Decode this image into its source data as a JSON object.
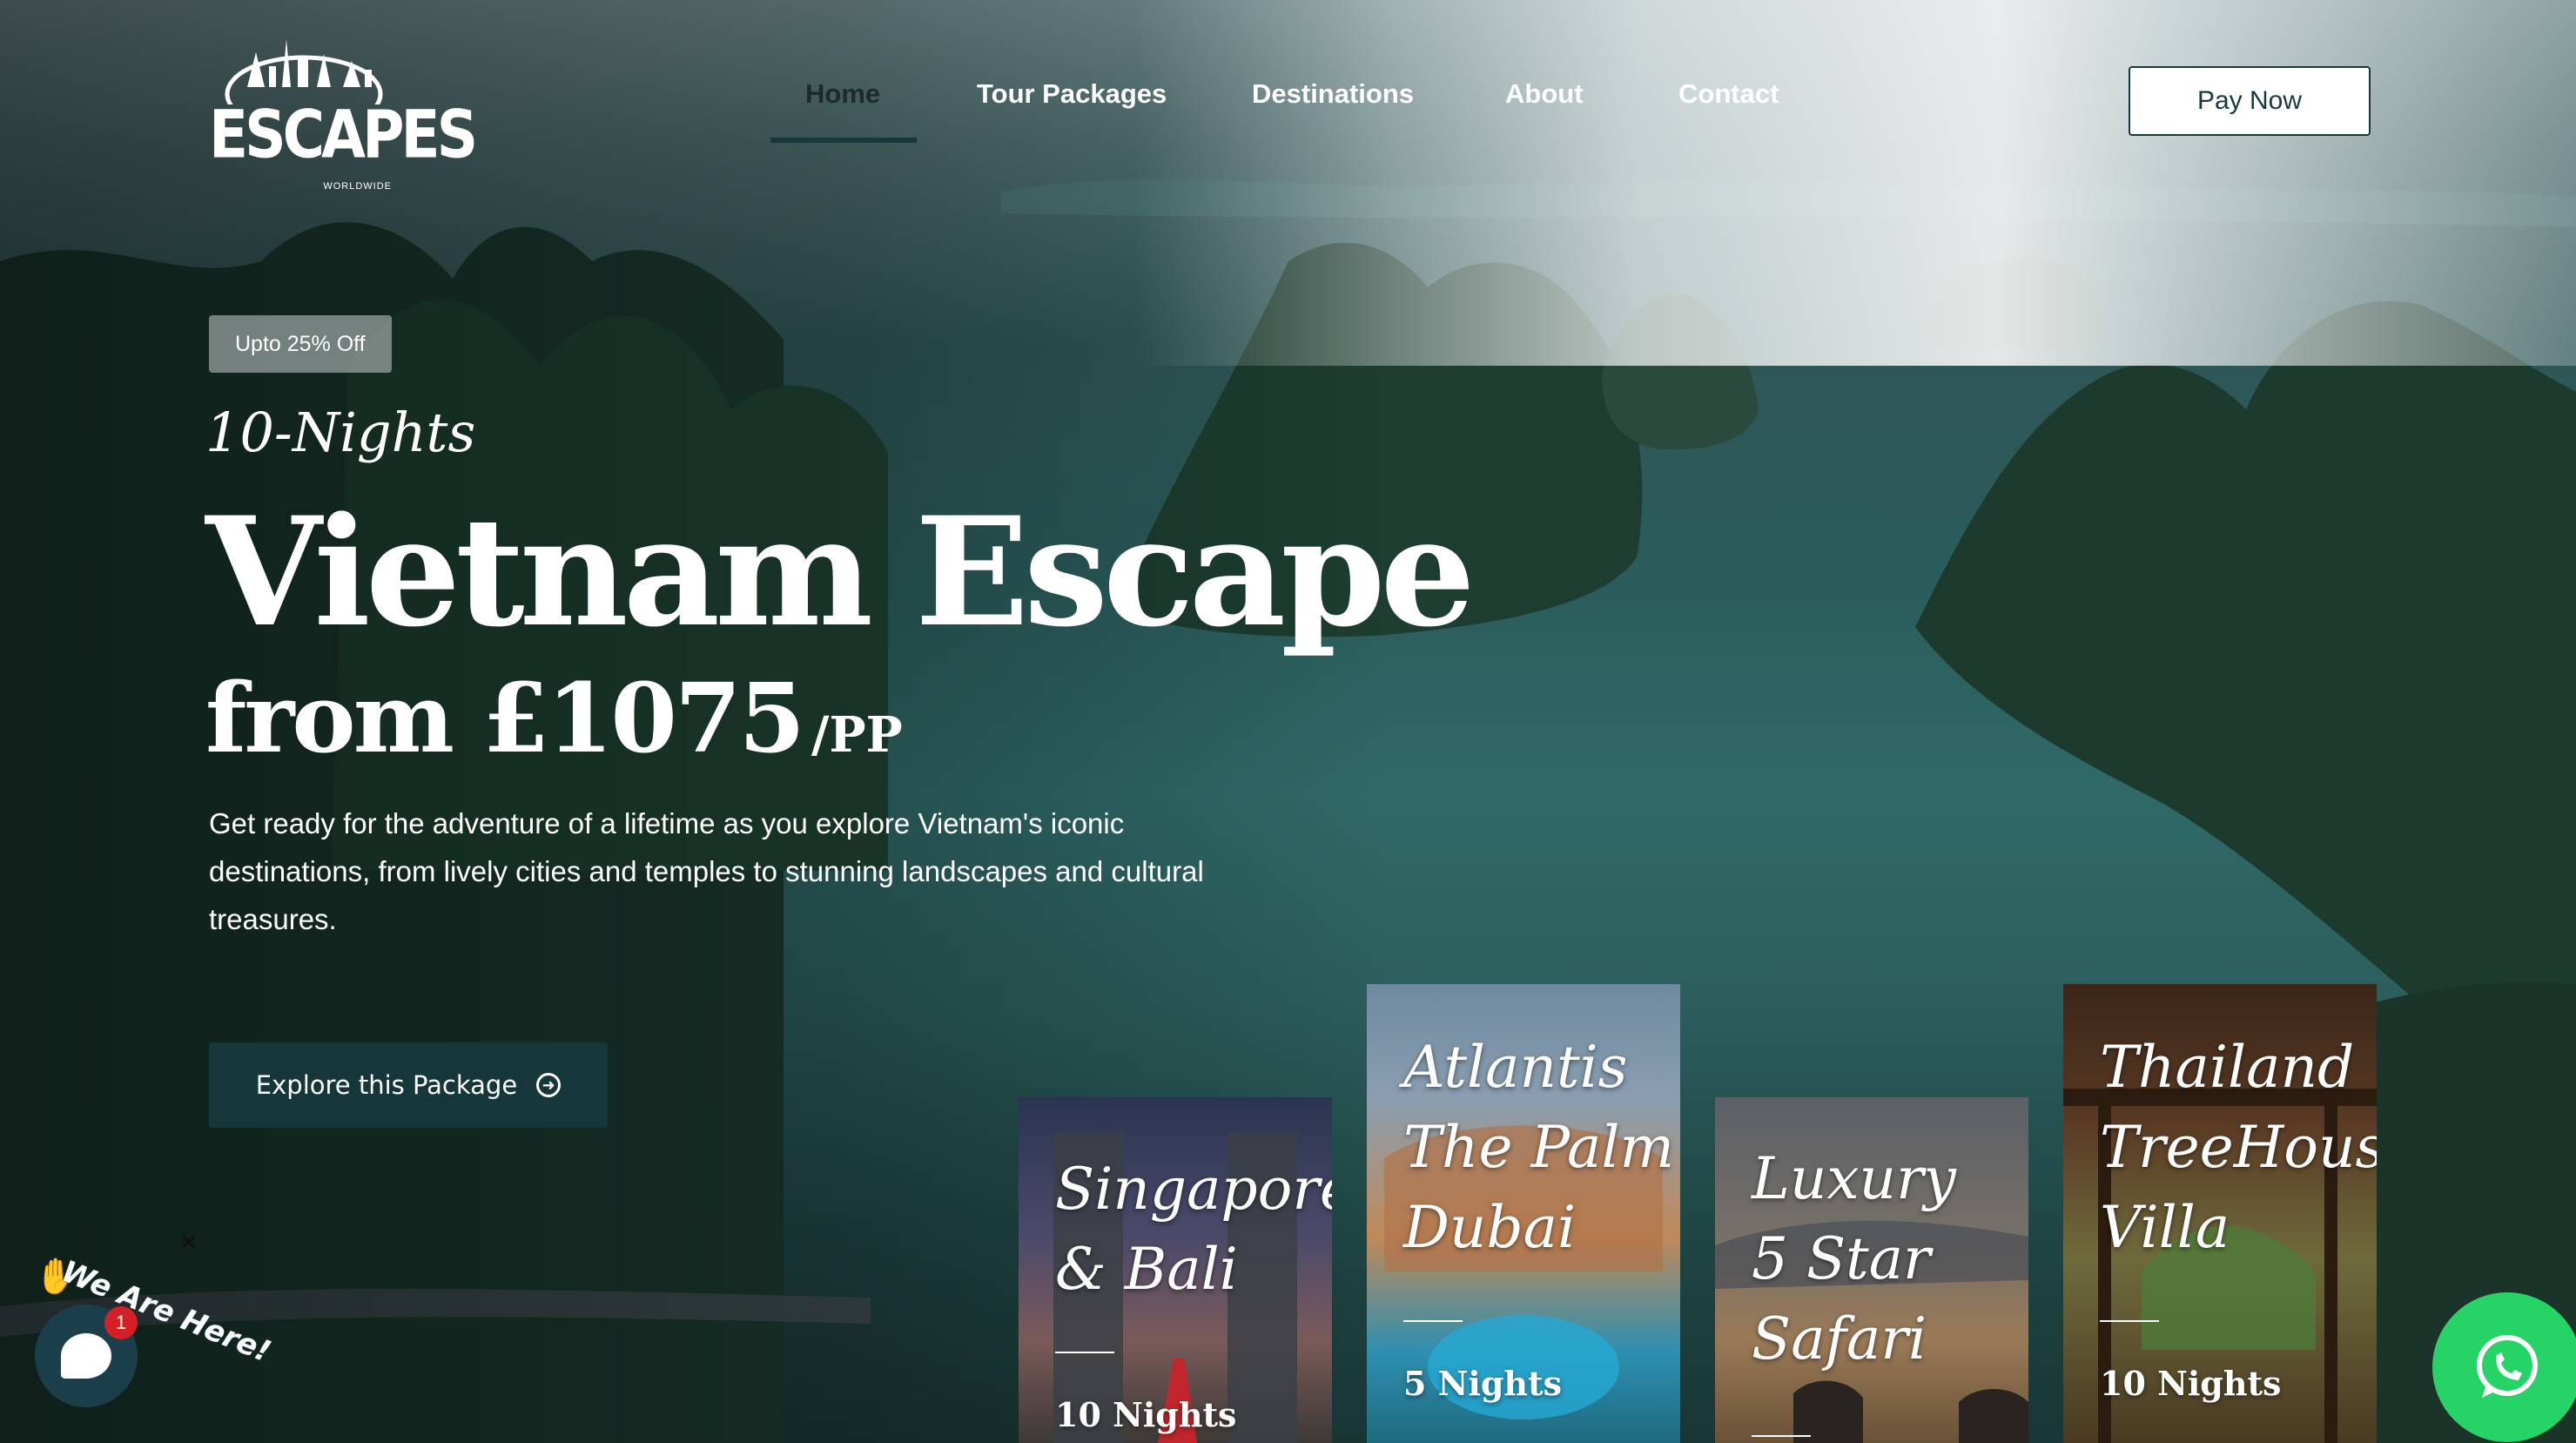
{
  "brand": {
    "name": "ESCAPES",
    "tagline": "WORLDWIDE"
  },
  "nav": {
    "items": [
      {
        "label": "Home",
        "active": true
      },
      {
        "label": "Tour Packages",
        "active": false
      },
      {
        "label": "Destinations",
        "active": false
      },
      {
        "label": "About",
        "active": false
      },
      {
        "label": "Contact",
        "active": false
      }
    ],
    "cta_label": "Pay Now"
  },
  "hero": {
    "badge": "Upto 25% Off",
    "nights": "10-Nights",
    "title": "Vietnam Escape",
    "price": "from £1075",
    "price_suffix": "/PP",
    "description": "Get ready for the adventure of a lifetime as you explore Vietnam's iconic destinations, from lively cities and temples to stunning landscapes and cultural treasures.",
    "button_label": "Explore this Package"
  },
  "packages": [
    {
      "title": "Singapore\n& Bali",
      "nights": "10 Nights"
    },
    {
      "title": "Atlantis\nThe Palm\nDubai",
      "nights": "5 Nights"
    },
    {
      "title": "Luxury\n5 Star\nSafari",
      "nights": ""
    },
    {
      "title": "Thailand\nTreeHouse\nVilla",
      "nights": "10 Nights"
    }
  ],
  "chat": {
    "label": "We Are Here!",
    "unread_count": "1",
    "close_glyph": "×"
  },
  "icons": {
    "chat": "chat-bubble-icon",
    "whatsapp": "whatsapp-icon",
    "arrow": "arrow-right-circle-icon"
  },
  "colors": {
    "primary": "#15373a",
    "whatsapp": "#25d366",
    "badge_red": "#d32027"
  }
}
